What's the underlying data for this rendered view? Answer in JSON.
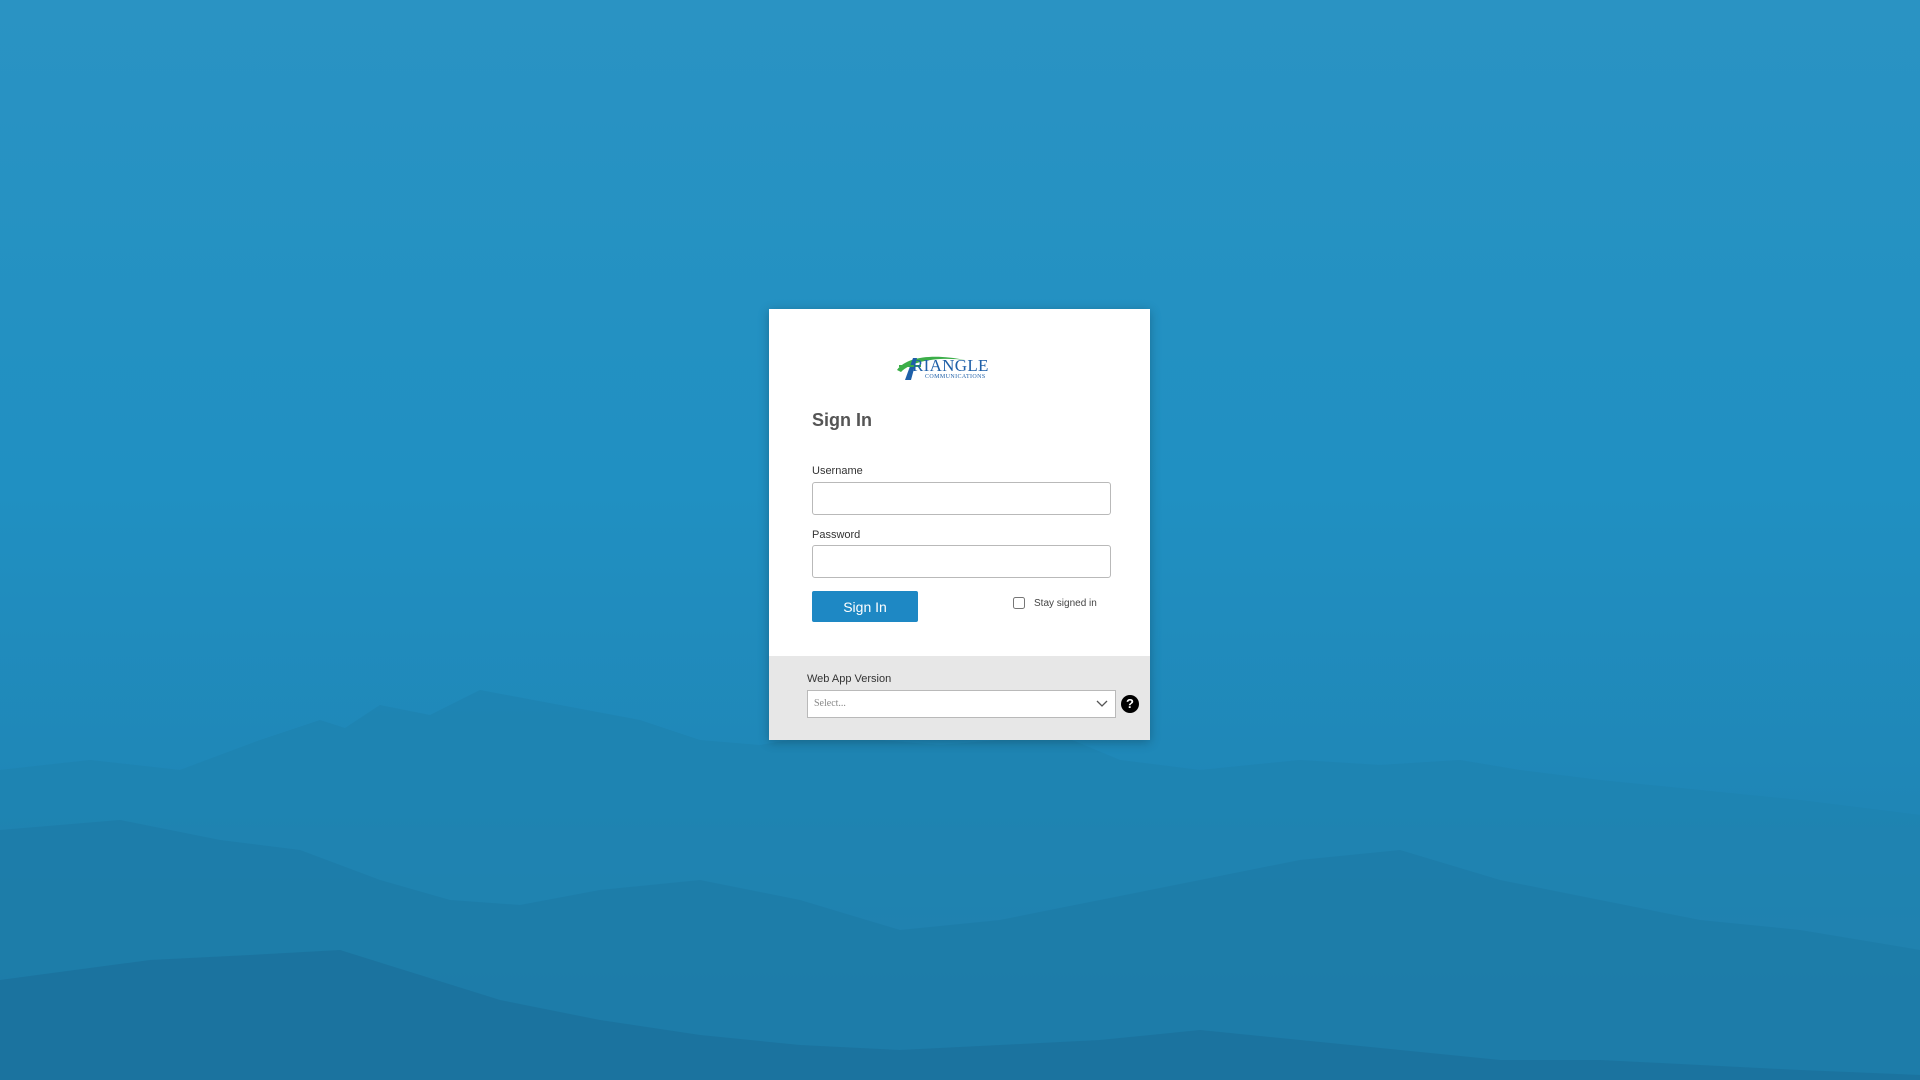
{
  "background": {
    "colors": {
      "sky": "#2090c2",
      "mountain": "#1d80ad"
    }
  },
  "logo": {
    "text": "RIANGLE",
    "subtext": "COMMUNICATIONS",
    "colors": {
      "blue": "#1e5fa8",
      "green": "#3cae49"
    }
  },
  "form": {
    "title": "Sign In",
    "username_label": "Username",
    "username_value": "",
    "password_label": "Password",
    "password_value": "",
    "signin_label": "Sign In",
    "stay_signed_in_label": "Stay signed in",
    "stay_signed_in_checked": false
  },
  "version": {
    "label": "Web App Version",
    "placeholder": "Select...",
    "help_icon": "?"
  },
  "colors": {
    "accent": "#1e88c4",
    "footer": "#e7e7e7"
  }
}
